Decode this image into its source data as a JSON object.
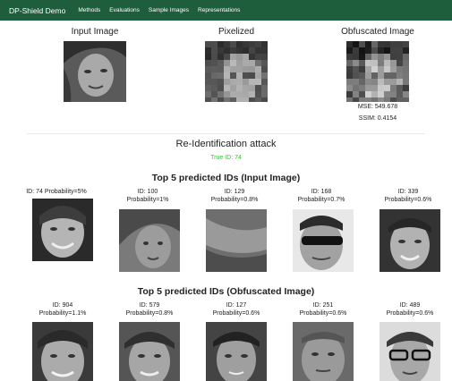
{
  "navbar": {
    "brand": "DP-Shield Demo",
    "links": [
      "Methods",
      "Evaluations",
      "Sample Images",
      "Representations"
    ]
  },
  "top": {
    "columns": [
      "Input Image",
      "Pixelized",
      "Obfuscated Image"
    ],
    "mse": "MSE: 549.678",
    "ssim": "SSIM: 0.4154"
  },
  "attack": {
    "title": "Re-Identification attack",
    "true_id": "True ID: 74"
  },
  "input_section": {
    "title": "Top 5 predicted IDs (Input Image)",
    "predictions": [
      {
        "id": "ID: 74 Probability=5%",
        "prob": ""
      },
      {
        "id": "ID: 100",
        "prob": "Probability=1%"
      },
      {
        "id": "ID: 129",
        "prob": "Probability=0.8%"
      },
      {
        "id": "ID: 168",
        "prob": "Probability=0.7%"
      },
      {
        "id": "ID: 339",
        "prob": "Probability=0.6%"
      }
    ]
  },
  "obf_section": {
    "title": "Top 5 predicted IDs (Obfuscated Image)",
    "predictions": [
      {
        "id": "ID: 904",
        "prob": "Probability=1.1%"
      },
      {
        "id": "ID: 579",
        "prob": "Probability=0.8%"
      },
      {
        "id": "ID: 127",
        "prob": "Probability=0.6%"
      },
      {
        "id": "ID: 251",
        "prob": "Probability=0.6%"
      },
      {
        "id": "ID: 489",
        "prob": "Probability=0.6%"
      }
    ]
  }
}
